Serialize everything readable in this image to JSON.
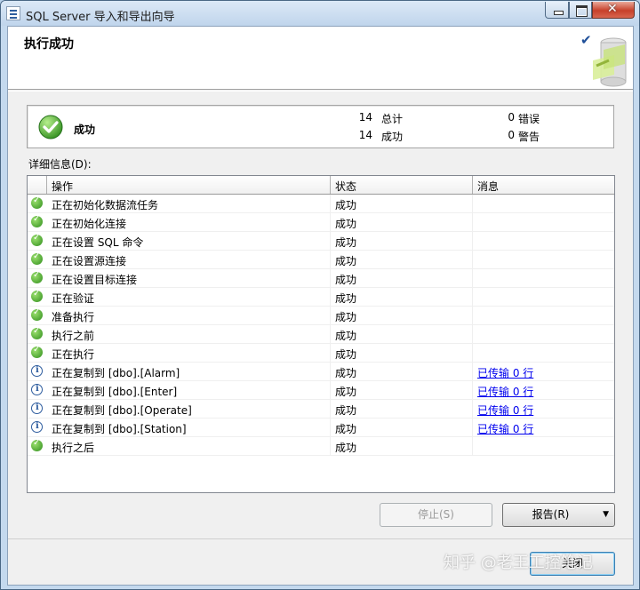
{
  "window": {
    "title": "SQL Server 导入和导出向导"
  },
  "header": {
    "title": "执行成功"
  },
  "summary": {
    "status": "成功",
    "total_count": "14",
    "total_label": "总计",
    "success_count": "14",
    "success_label": "成功",
    "error_count": "0",
    "error_label": "错误",
    "warning_count": "0",
    "warning_label": "警告"
  },
  "details": {
    "label": "详细信息(D):",
    "columns": [
      "操作",
      "状态",
      "消息"
    ],
    "rows": [
      {
        "icon": "success-icon",
        "action": "正在初始化数据流任务",
        "status": "成功",
        "message": ""
      },
      {
        "icon": "success-icon",
        "action": "正在初始化连接",
        "status": "成功",
        "message": ""
      },
      {
        "icon": "success-icon",
        "action": "正在设置 SQL 命令",
        "status": "成功",
        "message": ""
      },
      {
        "icon": "success-icon",
        "action": "正在设置源连接",
        "status": "成功",
        "message": ""
      },
      {
        "icon": "success-icon",
        "action": "正在设置目标连接",
        "status": "成功",
        "message": ""
      },
      {
        "icon": "success-icon",
        "action": "正在验证",
        "status": "成功",
        "message": ""
      },
      {
        "icon": "success-icon",
        "action": "准备执行",
        "status": "成功",
        "message": ""
      },
      {
        "icon": "success-icon",
        "action": "执行之前",
        "status": "成功",
        "message": ""
      },
      {
        "icon": "success-icon",
        "action": "正在执行",
        "status": "成功",
        "message": ""
      },
      {
        "icon": "info-icon",
        "action": "正在复制到 [dbo].[Alarm]",
        "status": "成功",
        "message": "已传输 0 行"
      },
      {
        "icon": "info-icon",
        "action": "正在复制到 [dbo].[Enter]",
        "status": "成功",
        "message": "已传输 0 行"
      },
      {
        "icon": "info-icon",
        "action": "正在复制到 [dbo].[Operate]",
        "status": "成功",
        "message": "已传输 0 行"
      },
      {
        "icon": "info-icon",
        "action": "正在复制到 [dbo].[Station]",
        "status": "成功",
        "message": "已传输 0 行"
      },
      {
        "icon": "success-icon",
        "action": "执行之后",
        "status": "成功",
        "message": ""
      }
    ]
  },
  "buttons": {
    "stop": "停止(S)",
    "report": "报告(R)",
    "close": "关闭"
  },
  "watermark": "知乎 @老王工控笔记",
  "colors": {
    "link": "#0000ee",
    "success": "#2f8d1c",
    "info": "#2d5c9e"
  }
}
